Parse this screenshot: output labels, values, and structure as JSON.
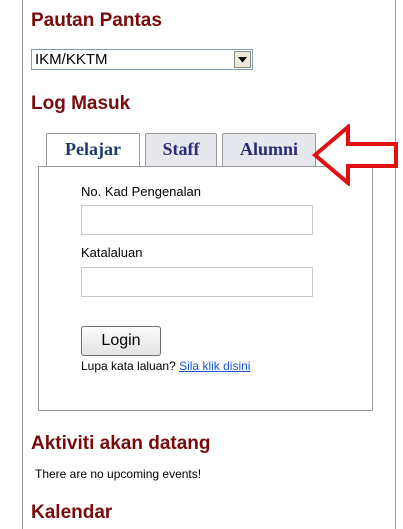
{
  "pautan": {
    "heading": "Pautan Pantas",
    "select_value": "IKM/KKTM"
  },
  "login": {
    "heading": "Log Masuk",
    "tabs": [
      {
        "label": "Pelajar",
        "active": true
      },
      {
        "label": "Staff",
        "active": false
      },
      {
        "label": "Alumni",
        "active": false
      }
    ],
    "ic_label": "No. Kad Pengenalan",
    "ic_value": "",
    "password_label": "Katalaluan",
    "password_value": "",
    "button_label": "Login",
    "forgot_text": "Lupa kata laluan?",
    "forgot_link": "Sila klik disini"
  },
  "aktiviti": {
    "heading": "Aktiviti akan datang",
    "empty_text": "There are no upcoming events!"
  },
  "kalendar": {
    "heading": "Kalendar"
  },
  "colors": {
    "heading": "#7a0b0b",
    "tab_text": "#2a2a7a",
    "link": "#1a54d0",
    "annotation_arrow": "#e01010"
  },
  "icons": {
    "dropdown": "chevron-down-icon",
    "annotation": "arrow-left-icon"
  }
}
